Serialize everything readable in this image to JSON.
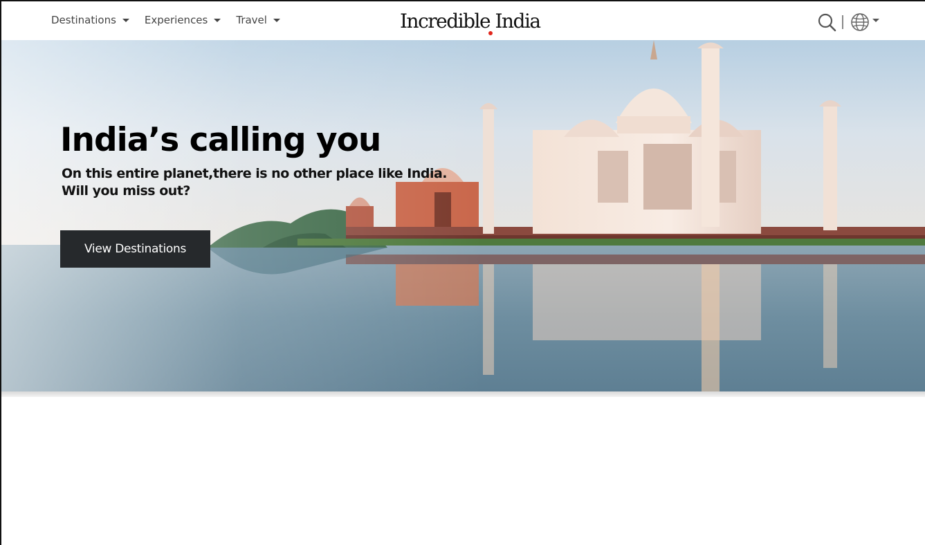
{
  "nav": {
    "items": [
      {
        "label": "Destinations"
      },
      {
        "label": "Experiences"
      },
      {
        "label": "Travel"
      }
    ]
  },
  "brand": {
    "logo_text": "Incredible India",
    "accent_color": "#e1261c"
  },
  "tools": {
    "search_icon": "search-icon",
    "language_icon": "globe-icon"
  },
  "hero": {
    "title": "India’s calling you",
    "subtitle_line1": "On this entire planet,there is no other place like India.",
    "subtitle_line2": "Will you miss out?",
    "cta_label": "View Destinations",
    "image": "taj-mahal-river-reflection"
  }
}
